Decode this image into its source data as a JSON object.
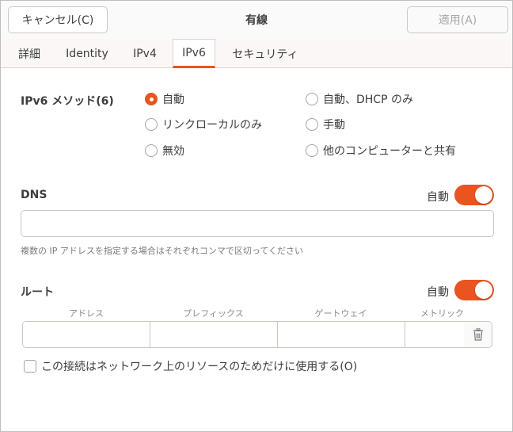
{
  "header": {
    "title": "有線",
    "cancel_label": "キャンセル(C)",
    "apply_label": "適用(A)"
  },
  "tabs": [
    {
      "label": "詳細",
      "active": false
    },
    {
      "label": "Identity",
      "active": false
    },
    {
      "label": "IPv4",
      "active": false
    },
    {
      "label": "IPv6",
      "active": true
    },
    {
      "label": "セキュリティ",
      "active": false
    }
  ],
  "method": {
    "label": "IPv6 メソッド(6)",
    "options": [
      {
        "label": "自動",
        "checked": true
      },
      {
        "label": "自動、DHCP のみ",
        "checked": false
      },
      {
        "label": "リンクローカルのみ",
        "checked": false
      },
      {
        "label": "手動",
        "checked": false
      },
      {
        "label": "無効",
        "checked": false
      },
      {
        "label": "他のコンピューターと共有",
        "checked": false
      }
    ]
  },
  "dns": {
    "label": "DNS",
    "auto_label": "自動",
    "auto_enabled": true,
    "value": "",
    "hint": "複数の IP アドレスを指定する場合はそれぞれコンマで区切ってください"
  },
  "routes": {
    "label": "ルート",
    "auto_label": "自動",
    "auto_enabled": true,
    "columns": [
      "アドレス",
      "プレフィックス",
      "ゲートウェイ",
      "メトリック"
    ],
    "row": [
      "",
      "",
      "",
      ""
    ]
  },
  "local_only": {
    "label": "この接続はネットワーク上のリソースのためだけに使用する(O)",
    "checked": false
  },
  "colors": {
    "accent": "#e95420",
    "tab_bar_bg": "#fbf7f7"
  },
  "icons": {
    "delete_route": "trash-icon"
  }
}
